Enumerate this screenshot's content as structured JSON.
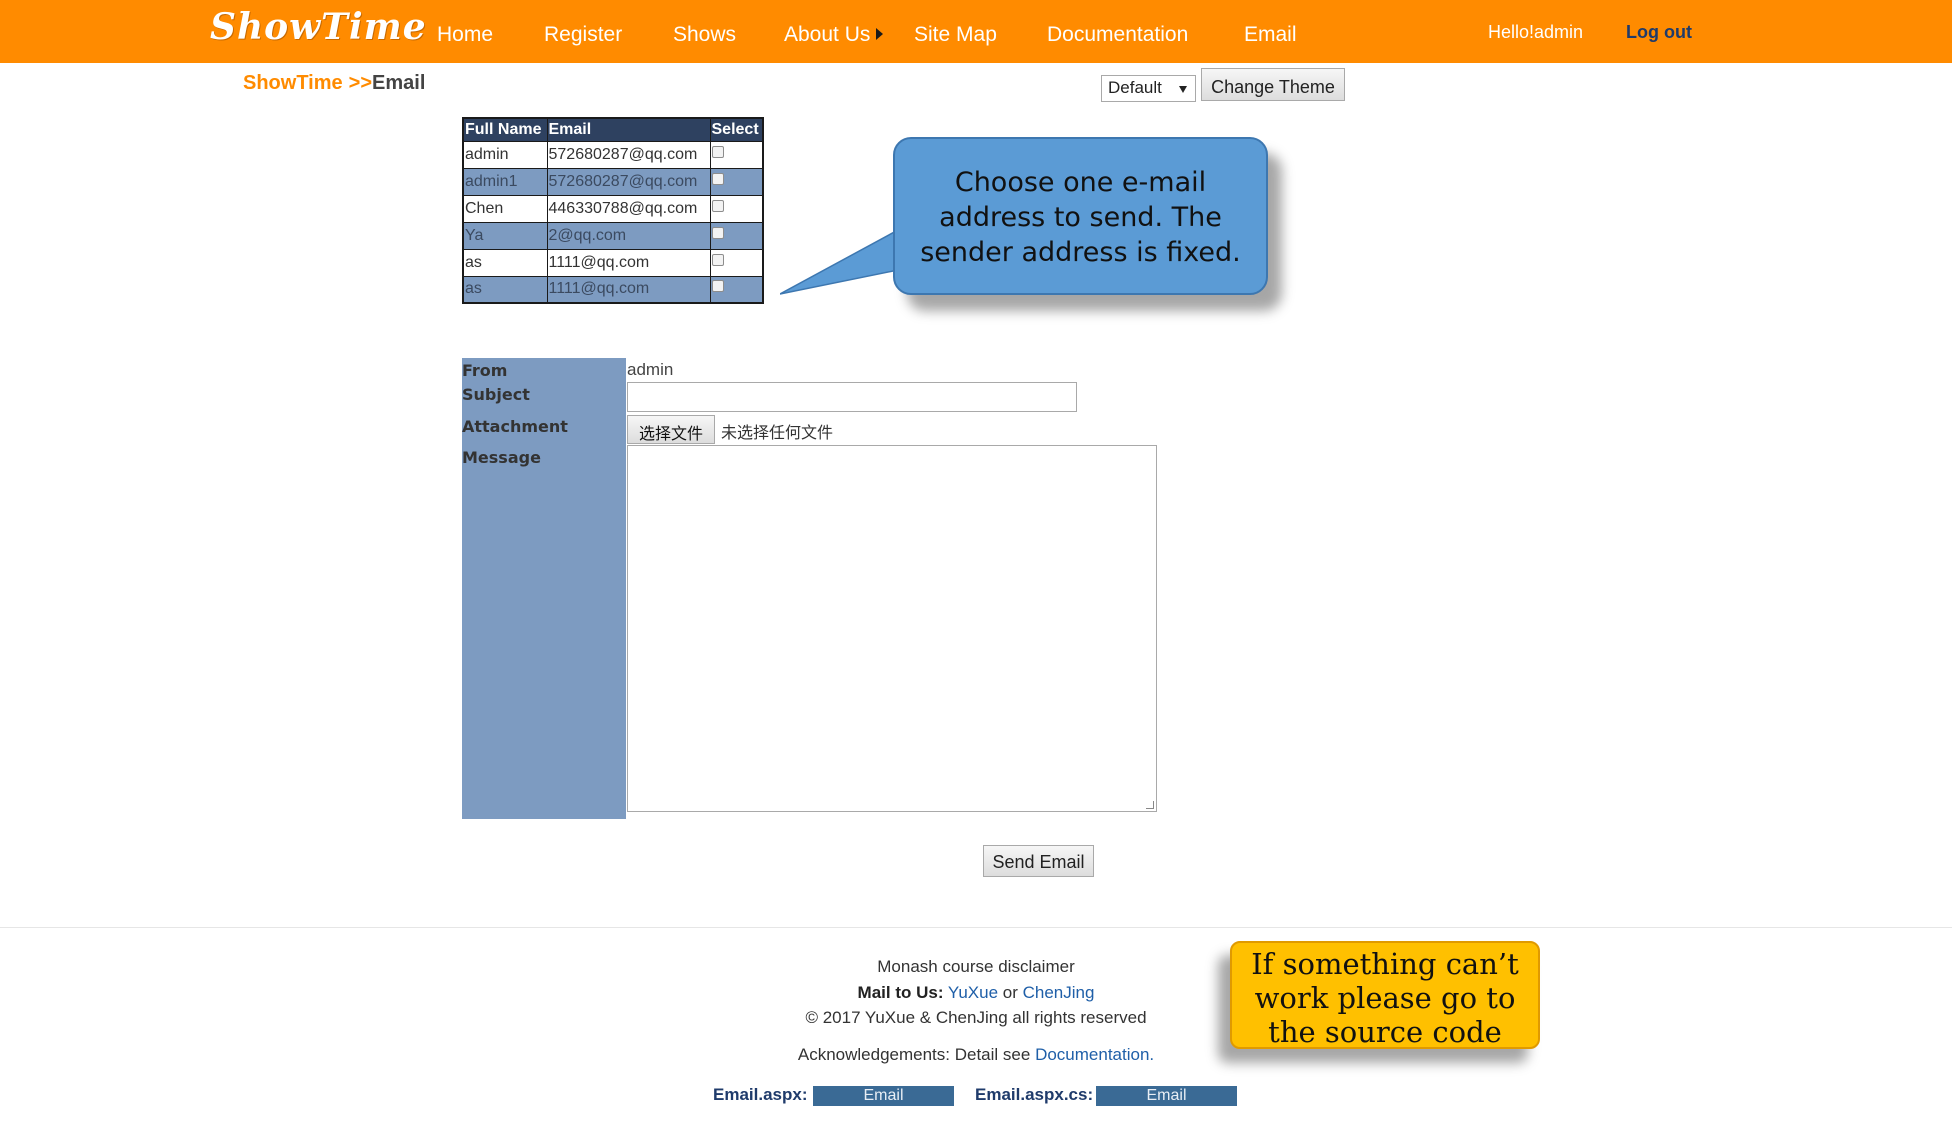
{
  "header": {
    "logo": "ShowTime",
    "nav": [
      "Home",
      "Register",
      "Shows",
      "About Us",
      "Site Map",
      "Documentation",
      "Email"
    ],
    "greeting": "Hello!admin",
    "logout": "Log out"
  },
  "breadcrumb": {
    "root": "ShowTime",
    "separator": ">>",
    "current": "Email"
  },
  "theme": {
    "selected": "Default",
    "button": "Change Theme"
  },
  "users_table": {
    "headers": [
      "Full Name",
      "Email",
      "Select"
    ],
    "rows": [
      {
        "name": "admin",
        "email": "572680287@qq.com"
      },
      {
        "name": "admin1",
        "email": "572680287@qq.com"
      },
      {
        "name": "Chen",
        "email": "446330788@qq.com"
      },
      {
        "name": "Ya",
        "email": "2@qq.com"
      },
      {
        "name": "as",
        "email": "1111@qq.com"
      },
      {
        "name": "as",
        "email": "1111@qq.com"
      }
    ]
  },
  "callouts": {
    "blue": [
      "Choose one e-mail",
      "address to send. The",
      "sender address is fixed."
    ],
    "yellow": [
      "If something can’t",
      "work please go to",
      "the source code"
    ]
  },
  "form": {
    "from_label": "From",
    "from_value": "admin",
    "subject_label": "Subject",
    "subject_value": "",
    "attachment_label": "Attachment",
    "file_button": "选择文件",
    "file_status": "未选择任何文件",
    "message_label": "Message",
    "message_value": "",
    "send_button": "Send Email"
  },
  "footer": {
    "disclaimer": "Monash course disclaimer",
    "mail_label": "Mail to Us:",
    "mail_link1": "YuXue",
    "mail_or": "or",
    "mail_link2": "ChenJing",
    "copyright": "© 2017 YuXue & ChenJing all rights reserved",
    "ack_text": "Acknowledgements: Detail see",
    "ack_link": "Documentation.",
    "src1_label": "Email.aspx:",
    "src1_button": "Email",
    "src2_label": "Email.aspx.cs:",
    "src2_button": "Email"
  },
  "colors": {
    "header_bg": "#ff8b00",
    "table_header": "#2e4160",
    "row_alt": "#7d9bc1",
    "callout_blue": "#5b9bd5",
    "callout_yellow": "#ffc000"
  }
}
